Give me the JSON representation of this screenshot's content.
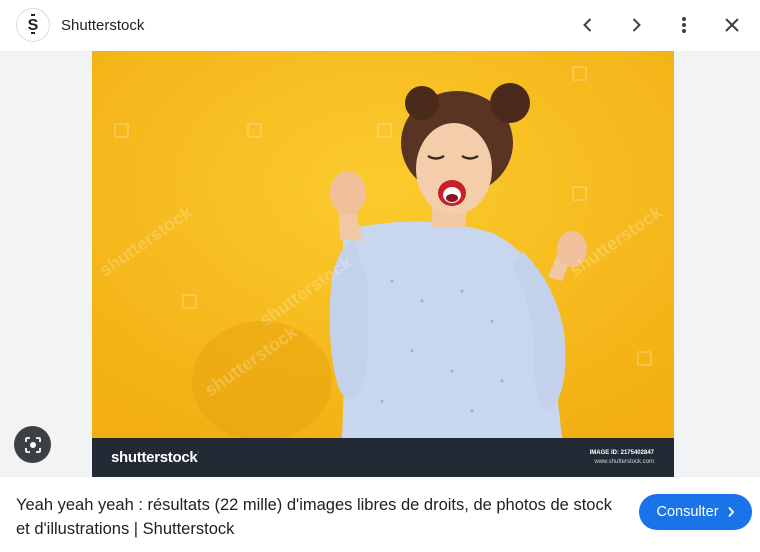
{
  "header": {
    "site_name": "Shutterstock",
    "logo_icon": "shutterstock-logo-icon",
    "buttons": {
      "previous": "chevron-left-icon",
      "next": "chevron-right-icon",
      "more": "more-vert-icon",
      "close": "close-icon"
    }
  },
  "image": {
    "brand": "shutterstock",
    "brand_mark": "·",
    "image_id": "IMAGE ID: 2175402847",
    "site_url": "www.shutterstock.com",
    "watermark": "shutterstock",
    "background_color": "#f7bd1f",
    "footer_color": "#222a36"
  },
  "lens_button": {
    "icon": "lens-search-icon"
  },
  "caption": "Yeah yeah yeah : résultats (22 mille) d'images libres de droits, de photos de stock et d'illustrations | Shutterstock",
  "visit_button": {
    "label": "Consulter",
    "icon": "chevron-right-icon",
    "color": "#1a73e8"
  }
}
